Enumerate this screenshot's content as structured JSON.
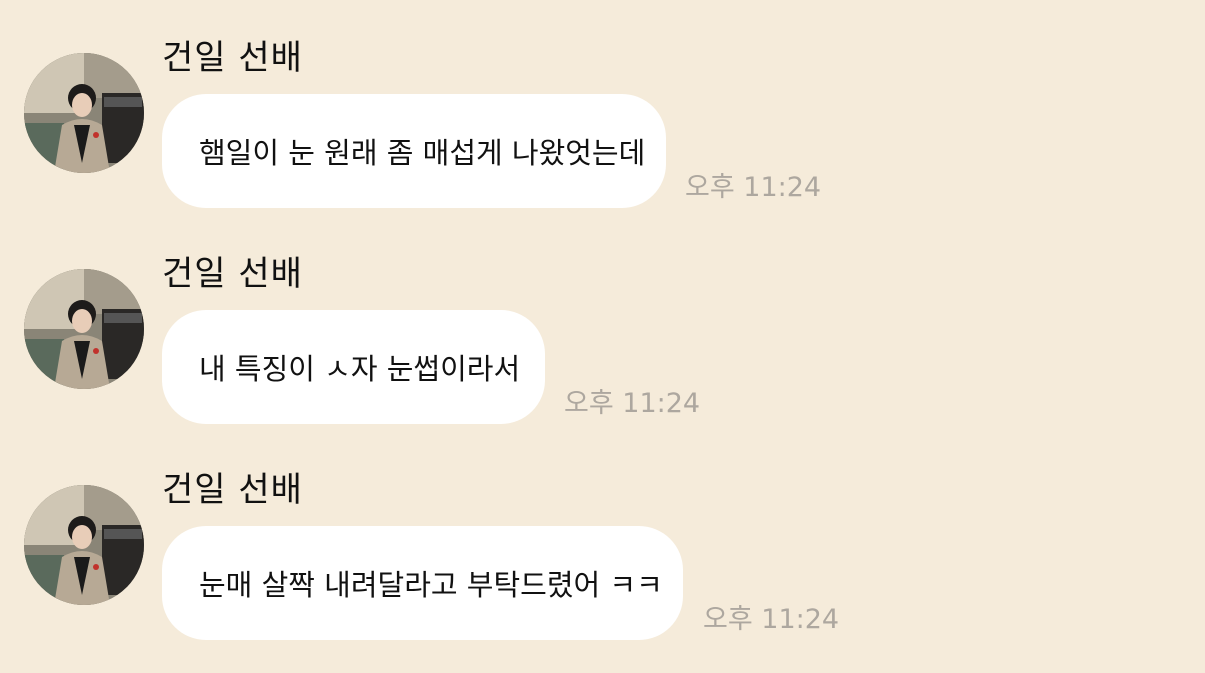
{
  "messages": [
    {
      "sender": "건일 선배",
      "text": "햄일이 눈 원래 좀 매섭게 나왔엇는데",
      "time": "오후 11:24"
    },
    {
      "sender": "건일 선배",
      "text": "내 특징이 ㅅ자 눈썹이라서",
      "time": "오후 11:24"
    },
    {
      "sender": "건일 선배",
      "text": "눈매 살짝 내려달라고 부탁드렸어 ㅋㅋ",
      "time": "오후 11:24"
    }
  ],
  "colors": {
    "background": "#f5ebda",
    "bubble": "#ffffff",
    "timestamp": "#ada79f"
  }
}
